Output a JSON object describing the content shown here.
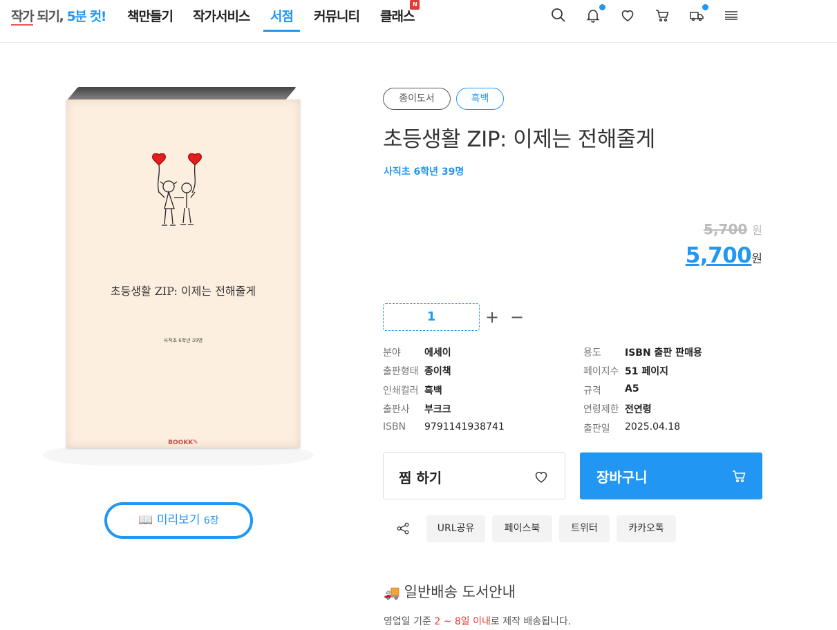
{
  "header": {
    "logo": {
      "part1": "작가",
      "part2": " 되기, ",
      "part3": "5분 컷!"
    },
    "nav": [
      {
        "label": "책만들기"
      },
      {
        "label": "작가서비스"
      },
      {
        "label": "서점"
      },
      {
        "label": "커뮤니티"
      },
      {
        "label": "클래스",
        "badge": "N"
      }
    ],
    "active_nav": "서점",
    "icons": [
      "search-icon",
      "bell-icon",
      "heart-icon",
      "cart-icon",
      "delivery-truck-icon",
      "menu-icon"
    ]
  },
  "book": {
    "cover_title": "초등생활 ZIP: 이제는 전해줄게",
    "cover_author": "사직초 6학년 39명",
    "cover_publisher": "BOOKK",
    "preview_label": "미리보기",
    "preview_count": "6장"
  },
  "product": {
    "tags": [
      "종이도서",
      "흑백"
    ],
    "title": "초등생활 ZIP: 이제는 전해줄게",
    "author": "사직초 6학년 39명",
    "price_original": "5,700",
    "price_original_unit": "원",
    "price": "5,700",
    "price_unit": "원",
    "quantity": "1",
    "plus": "+",
    "minus": "−"
  },
  "specs_left": [
    {
      "key": "분야",
      "value": "에세이"
    },
    {
      "key": "출판형태",
      "value": "종이책"
    },
    {
      "key": "인쇄컬러",
      "value": "흑백"
    },
    {
      "key": "출판사",
      "value": "부크크"
    },
    {
      "key": "ISBN",
      "value": "9791141938741"
    }
  ],
  "specs_right": [
    {
      "key": "용도",
      "value": "ISBN 출판 판매용"
    },
    {
      "key": "페이지수",
      "value": "51 페이지"
    },
    {
      "key": "규격",
      "value": "A5"
    },
    {
      "key": "연령제한",
      "value": "전연령"
    },
    {
      "key": "출판일",
      "value": "2025.04.18"
    }
  ],
  "actions": {
    "wish": "찜 하기",
    "cart": "장바구니"
  },
  "share": [
    "URL공유",
    "페이스북",
    "트위터",
    "카카오톡"
  ],
  "shipping": {
    "title": "일반배송 도서안내",
    "text_before": "영업일 기준 ",
    "text_highlight": "2 ~ 8일 이내",
    "text_after": "로 제작 배송됩니다."
  },
  "colors": {
    "accent": "#2196f3",
    "highlight": "#e53935",
    "cover": "#fdefe0"
  }
}
